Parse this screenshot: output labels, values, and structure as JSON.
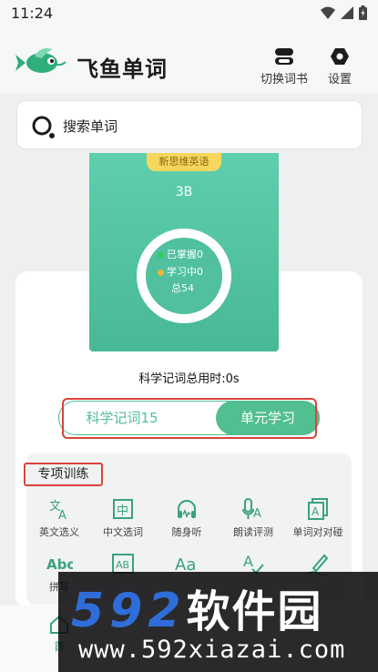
{
  "status_bar": {
    "time": "11:24"
  },
  "header": {
    "app_title": "飞鱼单词",
    "switch_book_label": "切换词书",
    "settings_label": "设置"
  },
  "search": {
    "placeholder": "搜索单词"
  },
  "book": {
    "tag": "新思维英语",
    "code": "3B",
    "mastered": "已掌握0",
    "learning": "学习中0",
    "total": "总54"
  },
  "study_time": "科学记词总用时:0s",
  "modes": {
    "left_label": "科学记词15",
    "right_label": "单元学习"
  },
  "special_training": {
    "title": "专项训练",
    "items": [
      {
        "label": "英文选义",
        "icon": "translate-icon"
      },
      {
        "label": "中文选词",
        "icon": "zhong-card-icon"
      },
      {
        "label": "随身听",
        "icon": "headphones-icon"
      },
      {
        "label": "朗读评测",
        "icon": "read-aloud-icon"
      },
      {
        "label": "单词对对碰",
        "icon": "match-cards-icon"
      },
      {
        "label": "拼写",
        "icon": "abc-icon"
      },
      {
        "label": "",
        "icon": "ab-box-icon"
      },
      {
        "label": "",
        "icon": "font-aa-icon"
      },
      {
        "label": "",
        "icon": "spell-check-icon"
      },
      {
        "label": "",
        "icon": "write-icon"
      }
    ]
  },
  "bottom_nav": {
    "home_label": "首"
  },
  "watermark": {
    "brand_digits": "592",
    "brand_cn": "软件园",
    "url": "www.592xiazai.com"
  },
  "colors": {
    "accent": "#52bf90",
    "highlight_frame": "#d9443a",
    "tag_yellow": "#f6d65c"
  }
}
